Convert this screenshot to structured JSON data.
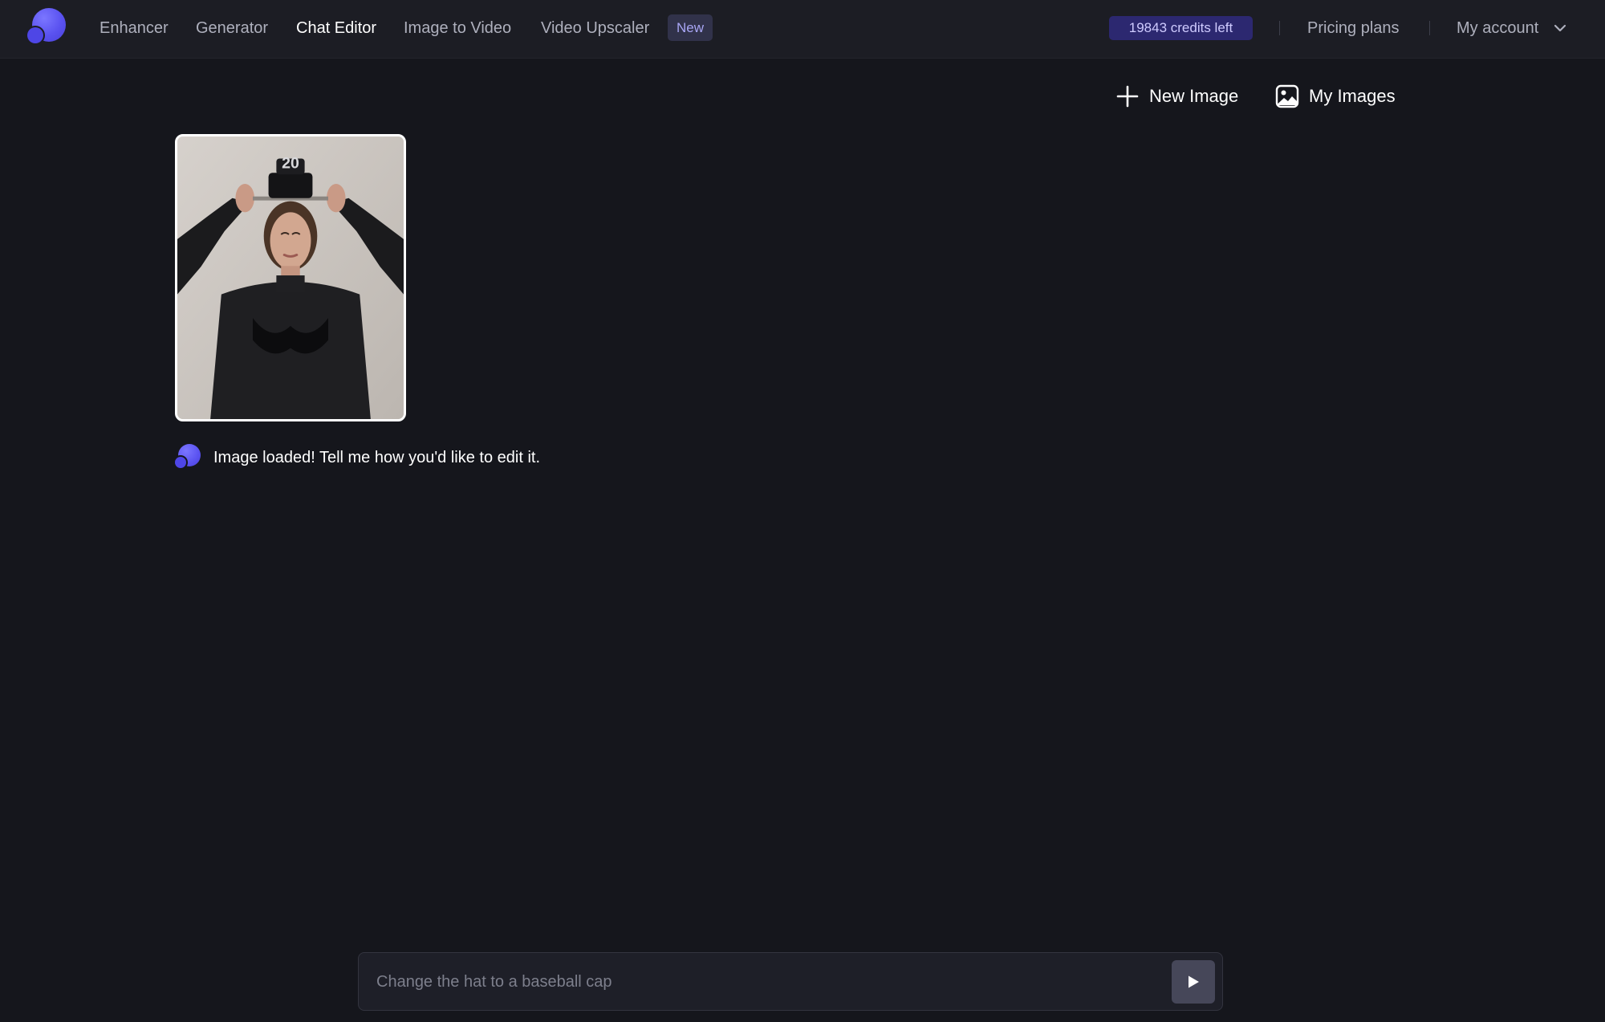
{
  "nav": {
    "logo_icon": "app-logo-icon",
    "links": [
      {
        "label": "Enhancer"
      },
      {
        "label": "Generator"
      },
      {
        "label": "Chat Editor",
        "active": true
      },
      {
        "label": "Image to Video"
      },
      {
        "label": "Video Upscaler"
      }
    ],
    "new_badge": "New",
    "credits": "19843 credits left",
    "pricing": "Pricing plans",
    "account": "My account",
    "account_icon": "chevron-down-icon"
  },
  "actions": {
    "new_image": {
      "label": "New Image",
      "icon": "plus-icon"
    },
    "my_images": {
      "label": "My Images",
      "icon": "image-icon"
    }
  },
  "chat": {
    "uploaded_image": {
      "icon": "uploaded-photo"
    },
    "bot_message": "Image loaded! Tell me how you'd like to edit it.",
    "bot_avatar_icon": "bot-avatar-icon"
  },
  "prompt": {
    "placeholder": "Change the hat to a baseball cap",
    "value": "",
    "send_icon": "send-play-icon"
  },
  "colors": {
    "background": "#15161c",
    "topbar": "#1c1d24",
    "accent": "#5a52f0",
    "credits_bg": "#2c2870",
    "credits_text": "#cfcbff",
    "badge_bg": "#31324a",
    "badge_text": "#a9a6f5"
  }
}
